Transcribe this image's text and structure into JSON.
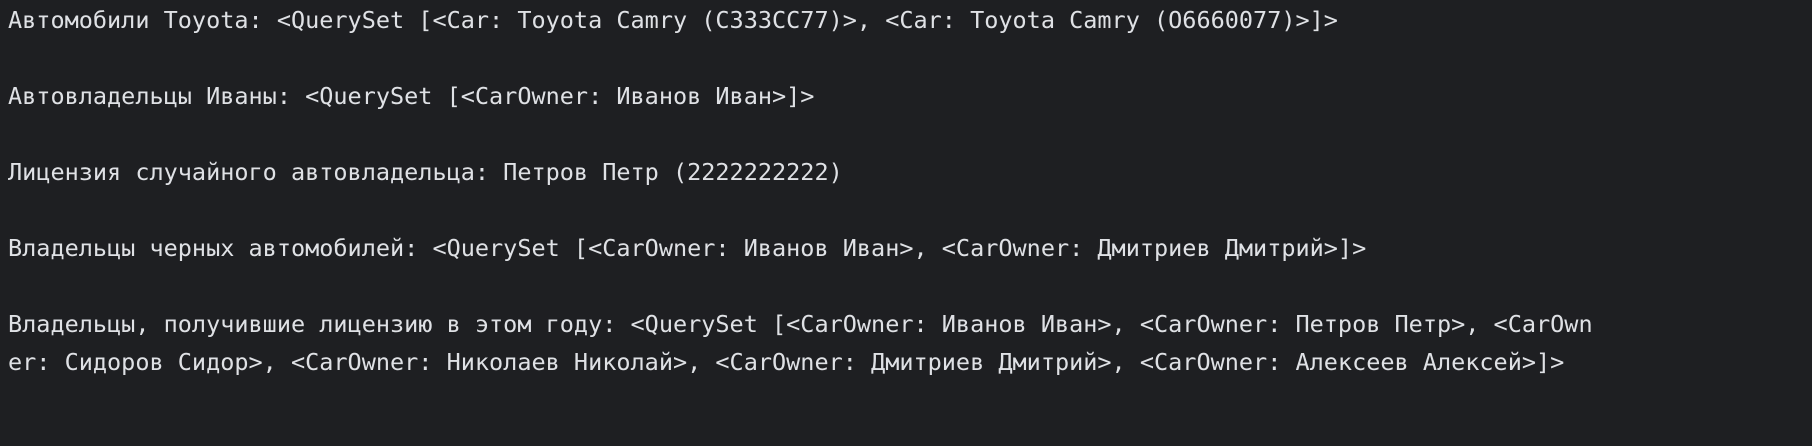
{
  "console": {
    "lines": [
      "Автомобили Toyota: <QuerySet [<Car: Toyota Camry (C333CC77)>, <Car: Toyota Camry (O6660077)>]>",
      "Автовладельцы Иваны: <QuerySet [<CarOwner: Иванов Иван>]>",
      "Лицензия случайного автовладельца: Петров Петр (2222222222)",
      "Владельцы черных автомобилей: <QuerySet [<CarOwner: Иванов Иван>, <CarOwner: Дмитриев Дмитрий>]>",
      "Владельцы, получившие лицензию в этом году: <QuerySet [<CarOwner: Иванов Иван>, <CarOwner: Петров Петр>, <CarOwn",
      "er: Сидоров Сидор>, <CarOwner: Николаев Николай>, <CarOwner: Дмитриев Дмитрий>, <CarOwner: Алексеев Алексей>]>"
    ],
    "background_color": "#1e1f22",
    "text_color": "#dfe1e5"
  }
}
